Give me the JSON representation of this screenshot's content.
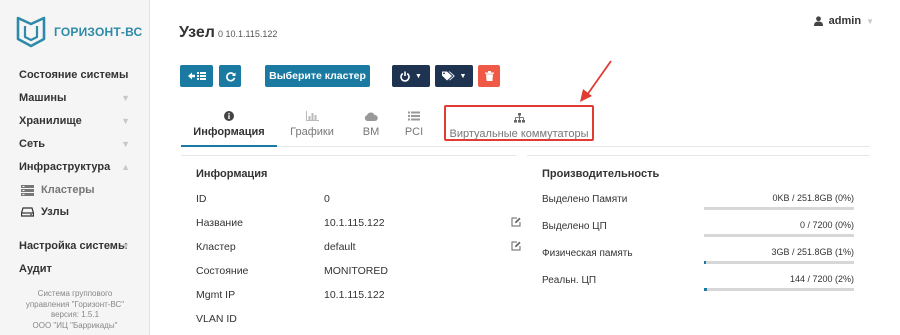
{
  "brand": {
    "name": "ГОРИЗОНТ-ВС",
    "color": "#2d8aa8",
    "logo_icon": "shield-logo-icon"
  },
  "sidebar": {
    "items": [
      {
        "label": "Состояние системы",
        "caret": false
      },
      {
        "label": "Машины",
        "caret": true
      },
      {
        "label": "Хранилище",
        "caret": true
      },
      {
        "label": "Сеть",
        "caret": true
      },
      {
        "label": "Инфраструктура",
        "caret": true,
        "expanded": true
      }
    ],
    "subitems": [
      {
        "label": "Кластеры",
        "icon": "server-stack-icon",
        "active": false
      },
      {
        "label": "Узлы",
        "icon": "hdd-icon",
        "active": true
      }
    ],
    "bottom_items": [
      {
        "label": "Настройка системы",
        "caret": true
      },
      {
        "label": "Аудит",
        "caret": false
      }
    ],
    "footer": {
      "line1": "Система группового",
      "line2": "управления \"Горизонт-ВС\"",
      "line3": "версия: 1.5.1",
      "line4": "ООО \"ИЦ \"Баррикады\""
    }
  },
  "header": {
    "title": "Узел",
    "subtitle": "0 10.1.115.122",
    "user": "admin"
  },
  "toolbar": {
    "back_icon": "back-list-icon",
    "refresh_icon": "refresh-icon",
    "select_cluster_label": "Выберите кластер",
    "power_icon": "power-icon",
    "tag_icon": "tag-icon",
    "delete_icon": "trash-icon",
    "colors": {
      "primary": "#1a7aa1",
      "dark": "#1e3350",
      "danger": "#ef5945"
    }
  },
  "tabs": [
    {
      "label": "Информация",
      "icon": "info-circle-icon",
      "active": true
    },
    {
      "label": "Графики",
      "icon": "bar-chart-icon",
      "active": false
    },
    {
      "label": "ВМ",
      "icon": "cloud-icon",
      "active": false
    },
    {
      "label": "PCI",
      "icon": "list-icon",
      "active": false
    },
    {
      "label": "Виртуальные коммутаторы",
      "icon": "sitemap-icon",
      "active": false,
      "highlighted": true
    }
  ],
  "info": {
    "title": "Информация",
    "rows": [
      {
        "key": "ID",
        "value": "0",
        "editable": false
      },
      {
        "key": "Название",
        "value": "10.1.115.122",
        "editable": true
      },
      {
        "key": "Кластер",
        "value": "default",
        "editable": true
      },
      {
        "key": "Состояние",
        "value": "MONITORED",
        "editable": false
      },
      {
        "key": "Mgmt IP",
        "value": "10.1.115.122",
        "editable": false
      },
      {
        "key": "VLAN ID",
        "value": "",
        "editable": false
      }
    ]
  },
  "performance": {
    "title": "Производительность",
    "rows": [
      {
        "key": "Выделено Памяти",
        "value": "0KB / 251.8GB (0%)",
        "percent": 0
      },
      {
        "key": "Выделено ЦП",
        "value": "0 / 7200 (0%)",
        "percent": 0
      },
      {
        "key": "Физическая память",
        "value": "3GB / 251.8GB (1%)",
        "percent": 1
      },
      {
        "key": "Реальн. ЦП",
        "value": "144 / 7200 (2%)",
        "percent": 2
      }
    ]
  },
  "annotation": {
    "color": "#e03c33"
  }
}
